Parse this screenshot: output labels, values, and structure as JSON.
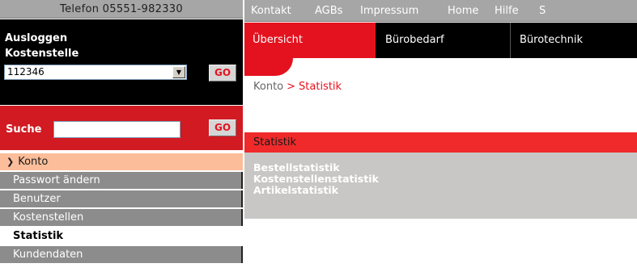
{
  "sidebar": {
    "phone": "Telefon 05551-982330",
    "logout": "Ausloggen",
    "cost_center_label": "Kostenstelle",
    "cost_center_value": "112346",
    "go_label": "GO",
    "search_label": "Suche",
    "search_value": "",
    "nav": [
      {
        "label": "Konto",
        "type": "section"
      },
      {
        "label": "Passwort ändern",
        "type": "item"
      },
      {
        "label": "Benutzer",
        "type": "item"
      },
      {
        "label": "Kostenstellen",
        "type": "item"
      },
      {
        "label": "Statistik",
        "type": "active"
      },
      {
        "label": "Kundendaten",
        "type": "item"
      }
    ]
  },
  "topnav": [
    "Kontakt",
    "AGBs",
    "Impressum",
    "Home",
    "Hilfe",
    "S"
  ],
  "tabs": [
    {
      "label": "Übersicht",
      "active": true
    },
    {
      "label": "Bürobedarf",
      "active": false
    },
    {
      "label": "Bürotechnik",
      "active": false
    }
  ],
  "breadcrumb": {
    "parent": "Konto",
    "separator": ">",
    "current": "Statistik"
  },
  "section_title": "Statistik",
  "stat_links": [
    "Bestellstatistik",
    "Kostenstellenstatistik",
    "Artikelstatistik"
  ],
  "colors": {
    "brand_red": "#e4121e",
    "bar_grey": "#a6a6a6",
    "nav_grey": "#8c8c8c",
    "highlight": "#fbbd9a"
  }
}
